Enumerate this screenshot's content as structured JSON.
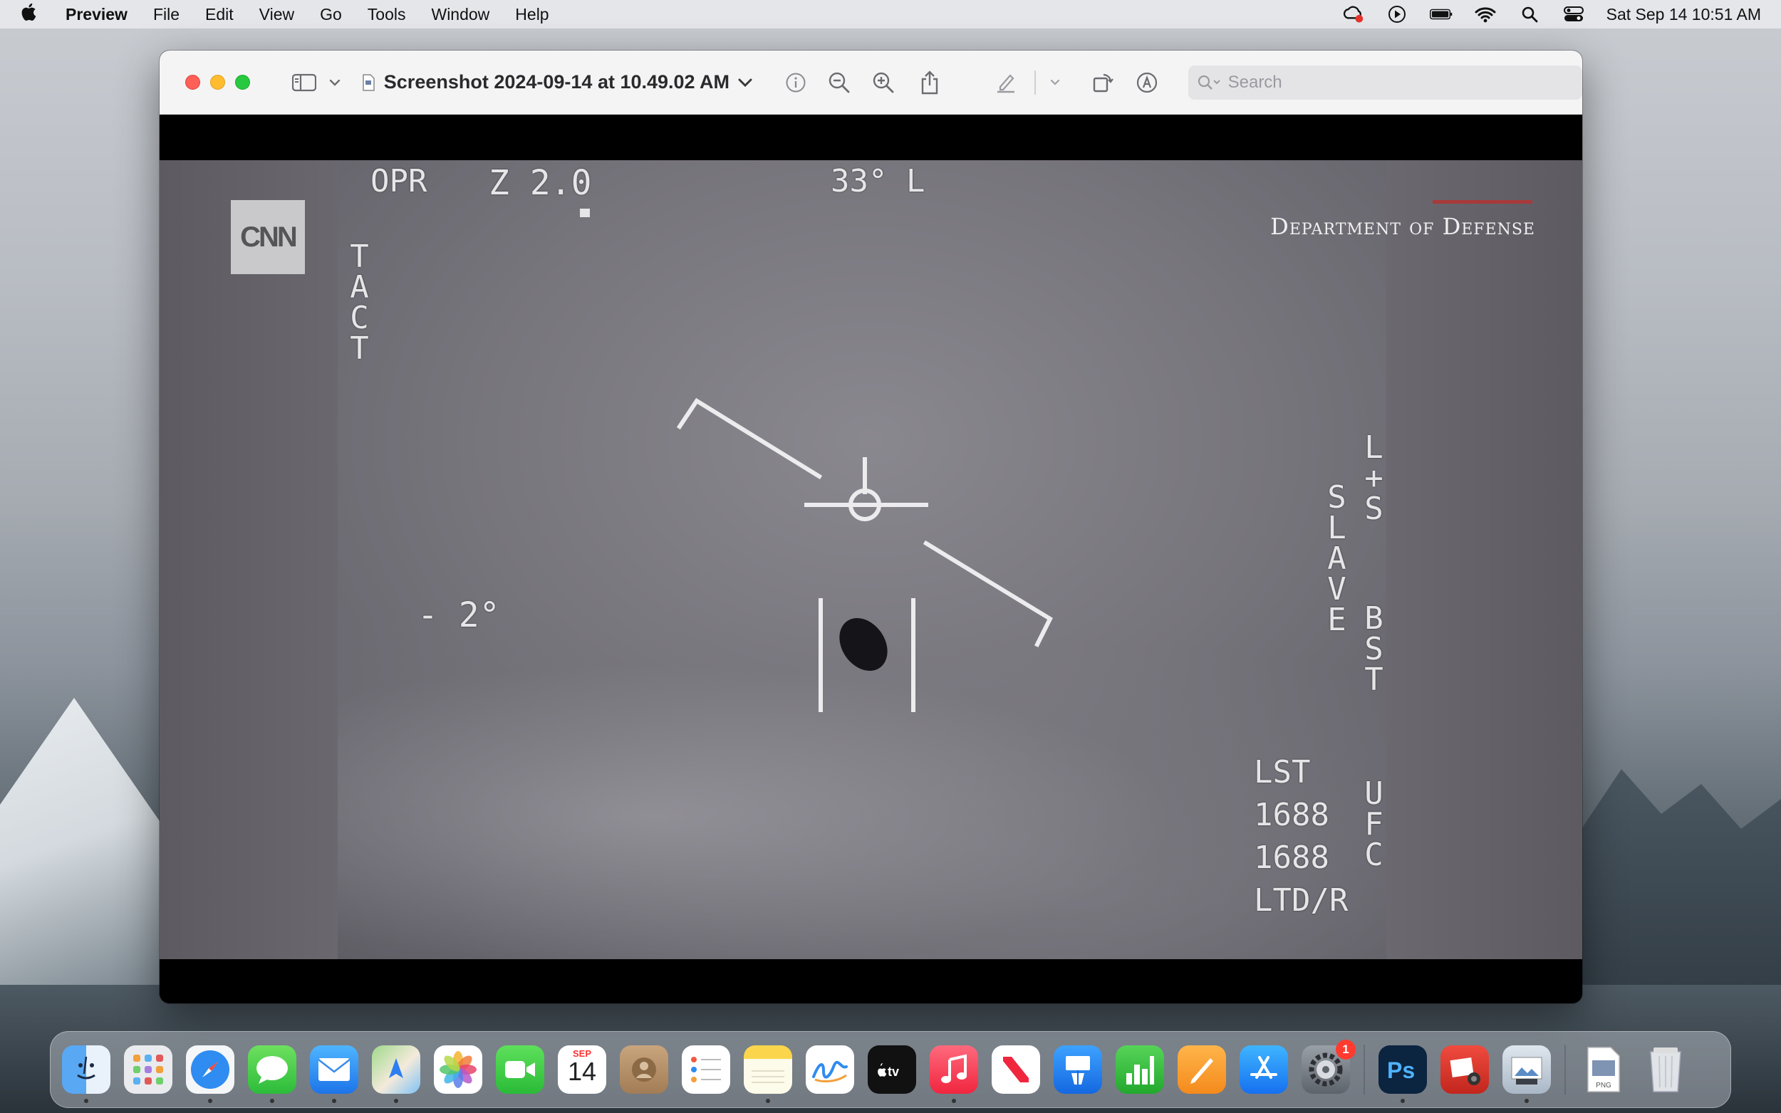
{
  "menubar": {
    "app_name": "Preview",
    "items": [
      "File",
      "Edit",
      "View",
      "Go",
      "Tools",
      "Window",
      "Help"
    ],
    "clock": "Sat Sep 14  10:51 AM"
  },
  "window": {
    "doc_title": "Screenshot 2024-09-14 at 10.49.02 AM",
    "search_placeholder": "Search"
  },
  "image": {
    "logo": "CNN",
    "dod_text": "Department of Defense",
    "hud": {
      "opr": "OPR",
      "zoom": "Z 2.0",
      "angle_top": "33° L",
      "tact": "TACT",
      "elev": "- 2°",
      "ls": "L+S",
      "slave": "SLAVE",
      "bst": "BST",
      "lst": "LST",
      "n1": "1688",
      "n2": "1688",
      "ltd": "LTD/R",
      "ufc": "UFC"
    }
  },
  "dock": {
    "calendar_month": "SEP",
    "calendar_day": "14",
    "settings_badge": "1",
    "apps": [
      "Finder",
      "Launchpad",
      "Safari",
      "Messages",
      "Mail",
      "Maps",
      "Photos",
      "FaceTime",
      "Calendar",
      "Contacts",
      "Reminders",
      "Notes",
      "Freeform",
      "TV",
      "Music",
      "News",
      "Keynote",
      "Numbers",
      "Pages",
      "App Store",
      "System Settings",
      "Photoshop",
      "Photo Booth",
      "Preview",
      "PNG",
      "Trash"
    ]
  },
  "colors": {
    "red_light": "#fe5f57",
    "yellow_light": "#febc2e",
    "green_light": "#28c840"
  }
}
